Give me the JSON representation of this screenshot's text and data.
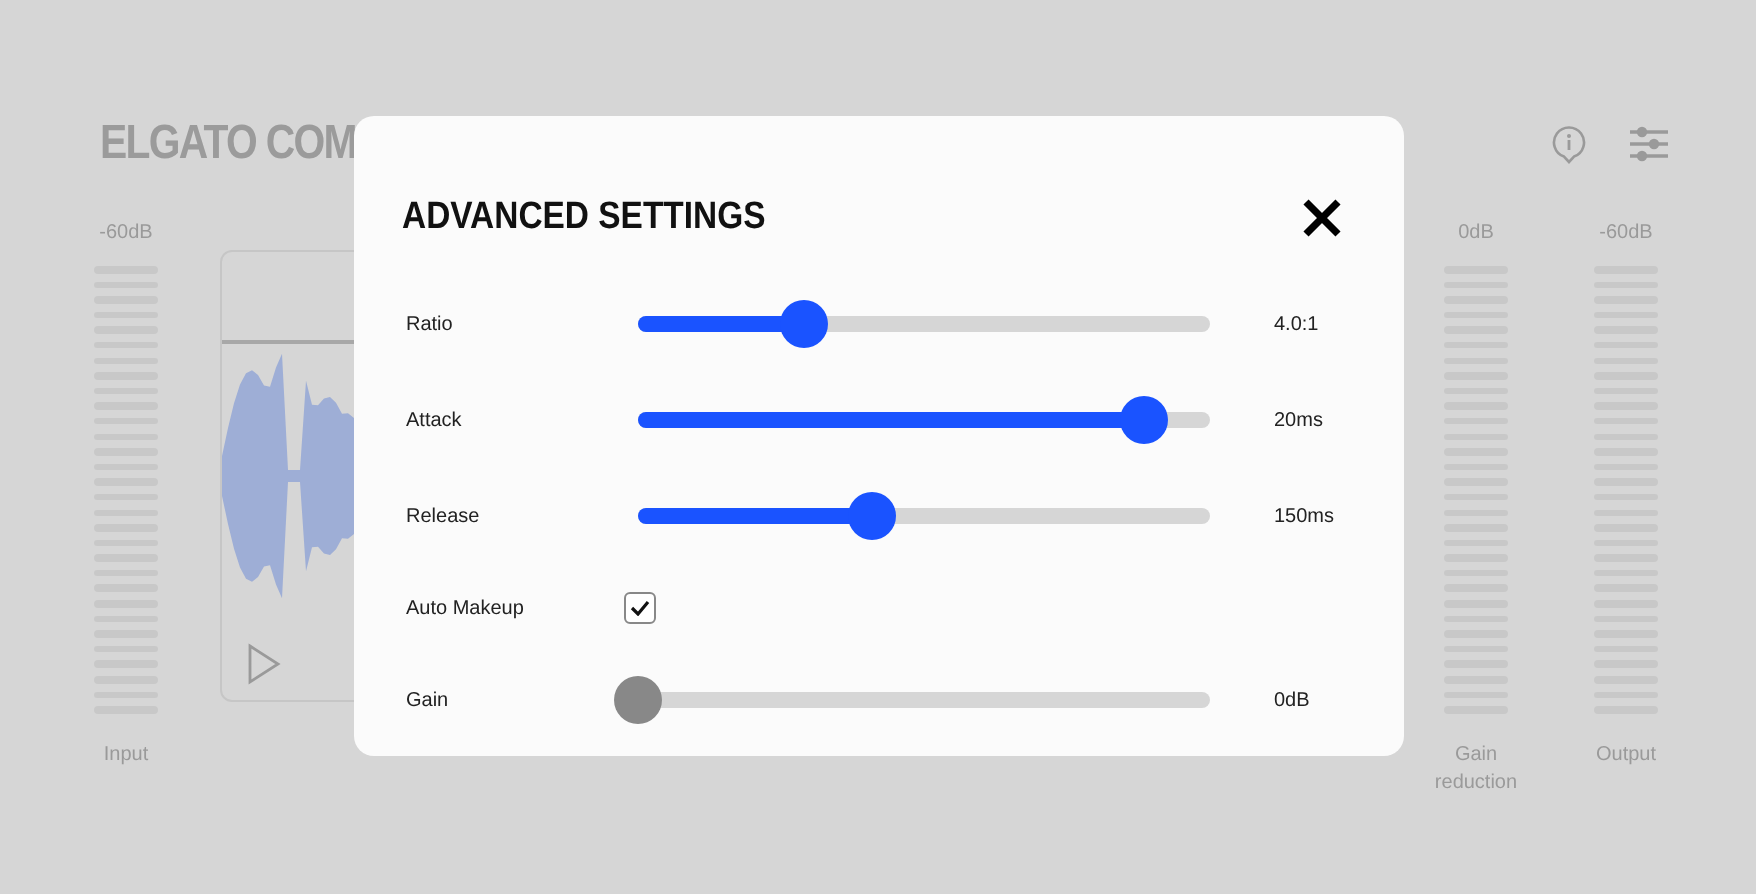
{
  "app": {
    "title": "ELGATO COM"
  },
  "meters": [
    {
      "top_label": "-60dB",
      "bottom_label": "Input"
    },
    {
      "top_label": "0dB",
      "bottom_label": "Gain reduction"
    },
    {
      "top_label": "-60dB",
      "bottom_label": "Output"
    }
  ],
  "dialog": {
    "title": "ADVANCED SETTINGS",
    "settings": [
      {
        "kind": "slider",
        "label": "Ratio",
        "level": 0.29,
        "reading": "4.0:1",
        "disabled": false
      },
      {
        "kind": "slider",
        "label": "Attack",
        "level": 0.885,
        "reading": "20ms",
        "disabled": false
      },
      {
        "kind": "slider",
        "label": "Release",
        "level": 0.41,
        "reading": "150ms",
        "disabled": false
      },
      {
        "kind": "checkbox",
        "label": "Auto Makeup",
        "checked": true
      },
      {
        "kind": "slider",
        "label": "Gain",
        "level": 0,
        "reading": "0dB",
        "disabled": true
      }
    ]
  }
}
